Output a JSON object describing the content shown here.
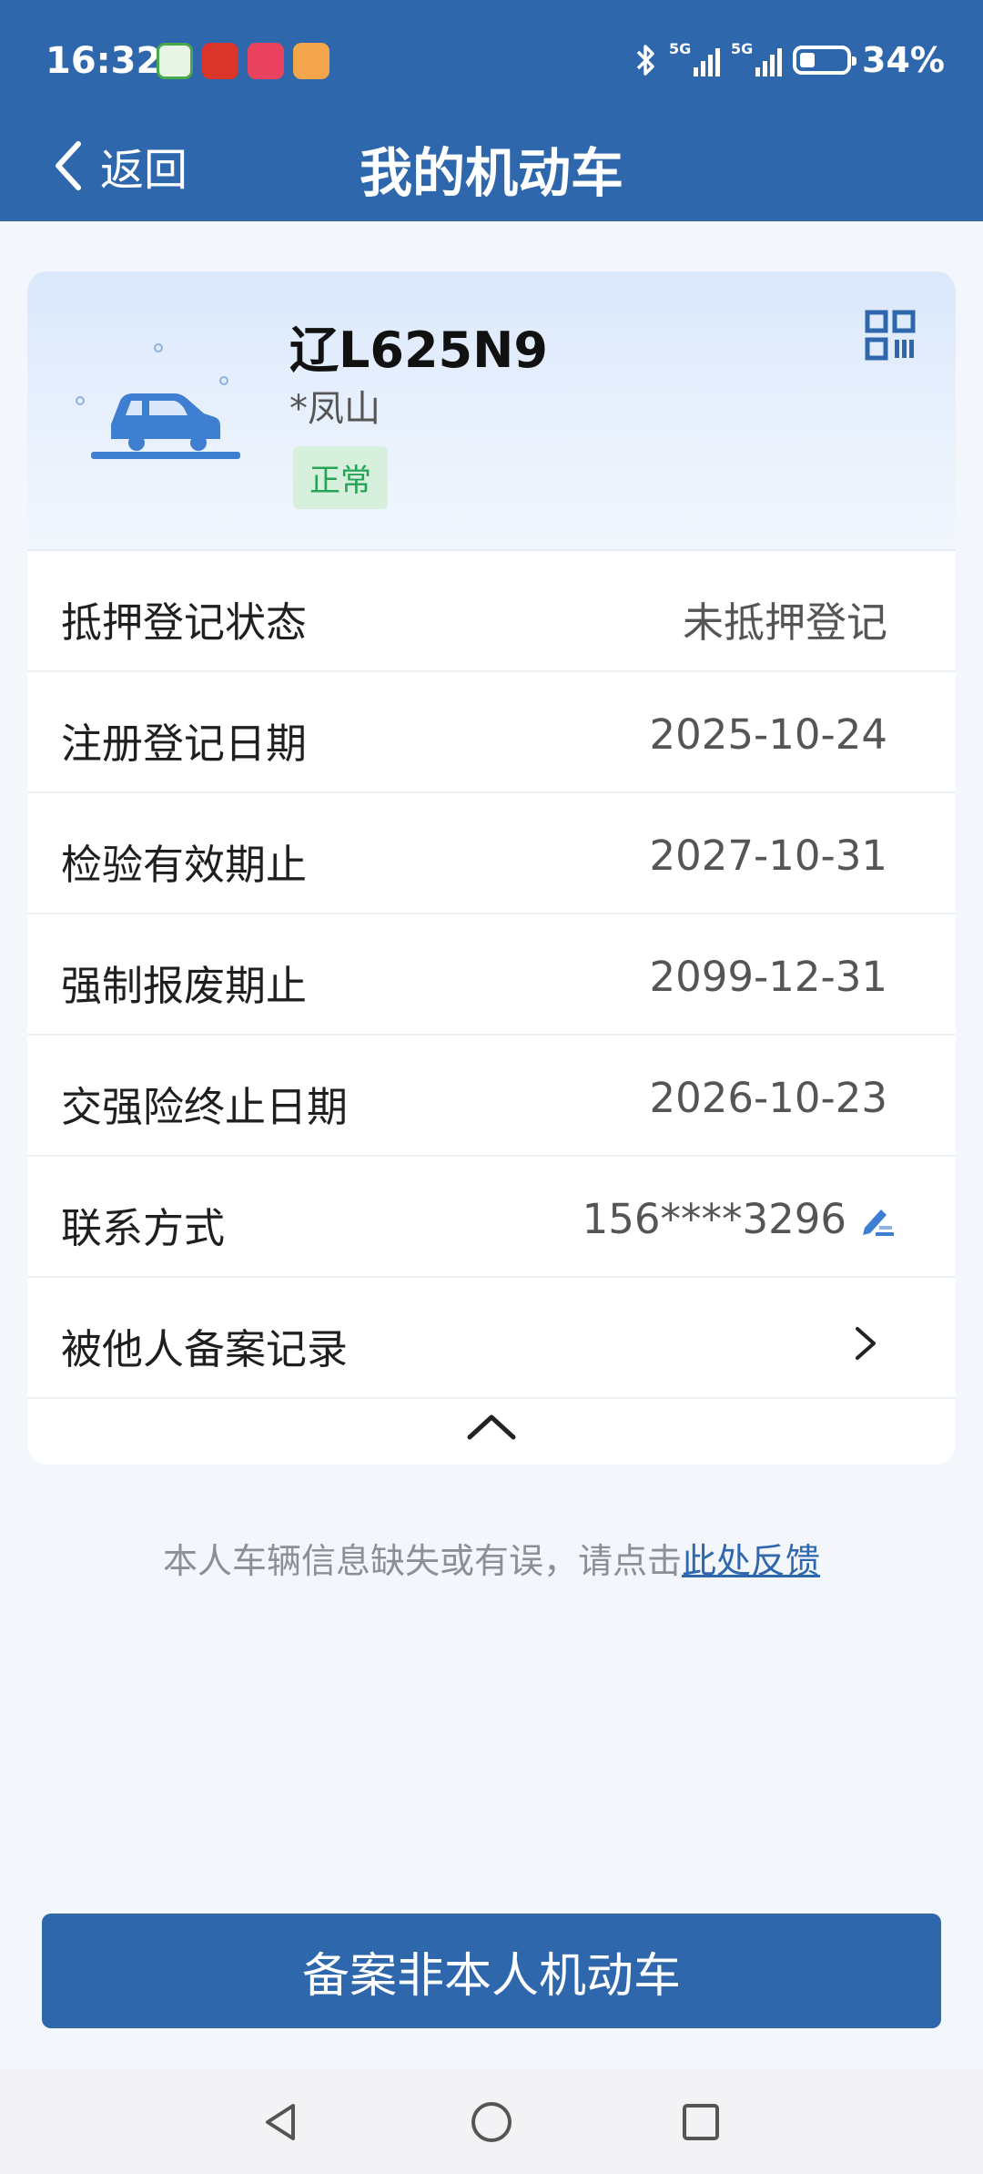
{
  "status_bar": {
    "time": "16:32",
    "network_1": "5G",
    "network_2": "5G",
    "battery": "34%",
    "battery_level": 0.34,
    "icons": [
      "app-green-icon",
      "app-red-icon",
      "app-pink-icon",
      "app-orange-icon",
      "bluetooth-icon"
    ]
  },
  "nav": {
    "back_label": "返回",
    "title": "我的机动车"
  },
  "vehicle": {
    "plate": "辽L625N9",
    "owner": "*凤山",
    "status": "正常"
  },
  "details": [
    {
      "label": "抵押登记状态",
      "value": "未抵押登记"
    },
    {
      "label": "注册登记日期",
      "value": "2025-10-24"
    },
    {
      "label": "检验有效期止",
      "value": "2027-10-31"
    },
    {
      "label": "强制报废期止",
      "value": "2099-12-31"
    },
    {
      "label": "交强险终止日期",
      "value": "2026-10-23"
    },
    {
      "label": "联系方式",
      "value": "156****3296"
    },
    {
      "label": "被他人备案记录",
      "value": ""
    }
  ],
  "feedback": {
    "text": "本人车辆信息缺失或有误，请点击",
    "link": "此处反馈"
  },
  "primary_button": "备案非本人机动车",
  "colors": {
    "brand": "#2f67ad",
    "status_ok_bg": "#d7f0de",
    "status_ok_text": "#26a355"
  }
}
